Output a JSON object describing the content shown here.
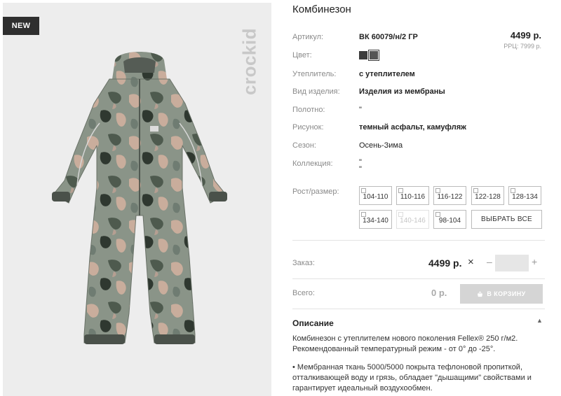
{
  "badge": "NEW",
  "brand": "crockid",
  "product": {
    "title": "Комбинезон",
    "price": "4499 р.",
    "rrp": "РРЦ: 7999 р.",
    "rows": [
      {
        "label": "Артикул:",
        "value": "ВК 60079/н/2 ГР"
      },
      {
        "label": "Цвет:",
        "value": ""
      },
      {
        "label": "Утеплитель:",
        "value": "с утеплителем"
      },
      {
        "label": "Вид изделия:",
        "value": "Изделия из мембраны"
      },
      {
        "label": "Полотно:",
        "value": "\""
      },
      {
        "label": "Рисунок:",
        "value": "темный асфальт, камуфляж"
      },
      {
        "label": "Сезон:",
        "value": "Осень-Зима"
      },
      {
        "label": "Коллекция:",
        "value": "\""
      },
      {
        "label": "Рост/размер:",
        "value": ""
      }
    ],
    "collection_extra": "\""
  },
  "colors": [
    "#3c3c3c",
    "#555555"
  ],
  "sizes": [
    {
      "label": "104-110",
      "available": true
    },
    {
      "label": "110-116",
      "available": true
    },
    {
      "label": "116-122",
      "available": true
    },
    {
      "label": "122-128",
      "available": true
    },
    {
      "label": "128-134",
      "available": true
    },
    {
      "label": "134-140",
      "available": true
    },
    {
      "label": "140-146",
      "available": false
    },
    {
      "label": "98-104",
      "available": true
    }
  ],
  "select_all": "ВЫБРАТЬ ВСЕ",
  "order": {
    "label": "Заказ:",
    "price": "4499 р.",
    "times": "×",
    "minus": "–",
    "plus": "+",
    "qty": ""
  },
  "total": {
    "label": "Всего:",
    "value": "0 р.",
    "cart_button": "В КОРЗИНУ"
  },
  "description": {
    "title": "Описание",
    "p1": "Комбинезон с утеплителем нового поколения Fellex® 250 г/м2. Рекомендованный температурный режим - от 0° до -25°.",
    "p2": "• Мембранная ткань 5000/5000 покрыта тефлоновой пропиткой, отталкивающей воду и грязь, обладает \"дышащими\" свойствами и гарантирует идеальный воздухообмен."
  }
}
